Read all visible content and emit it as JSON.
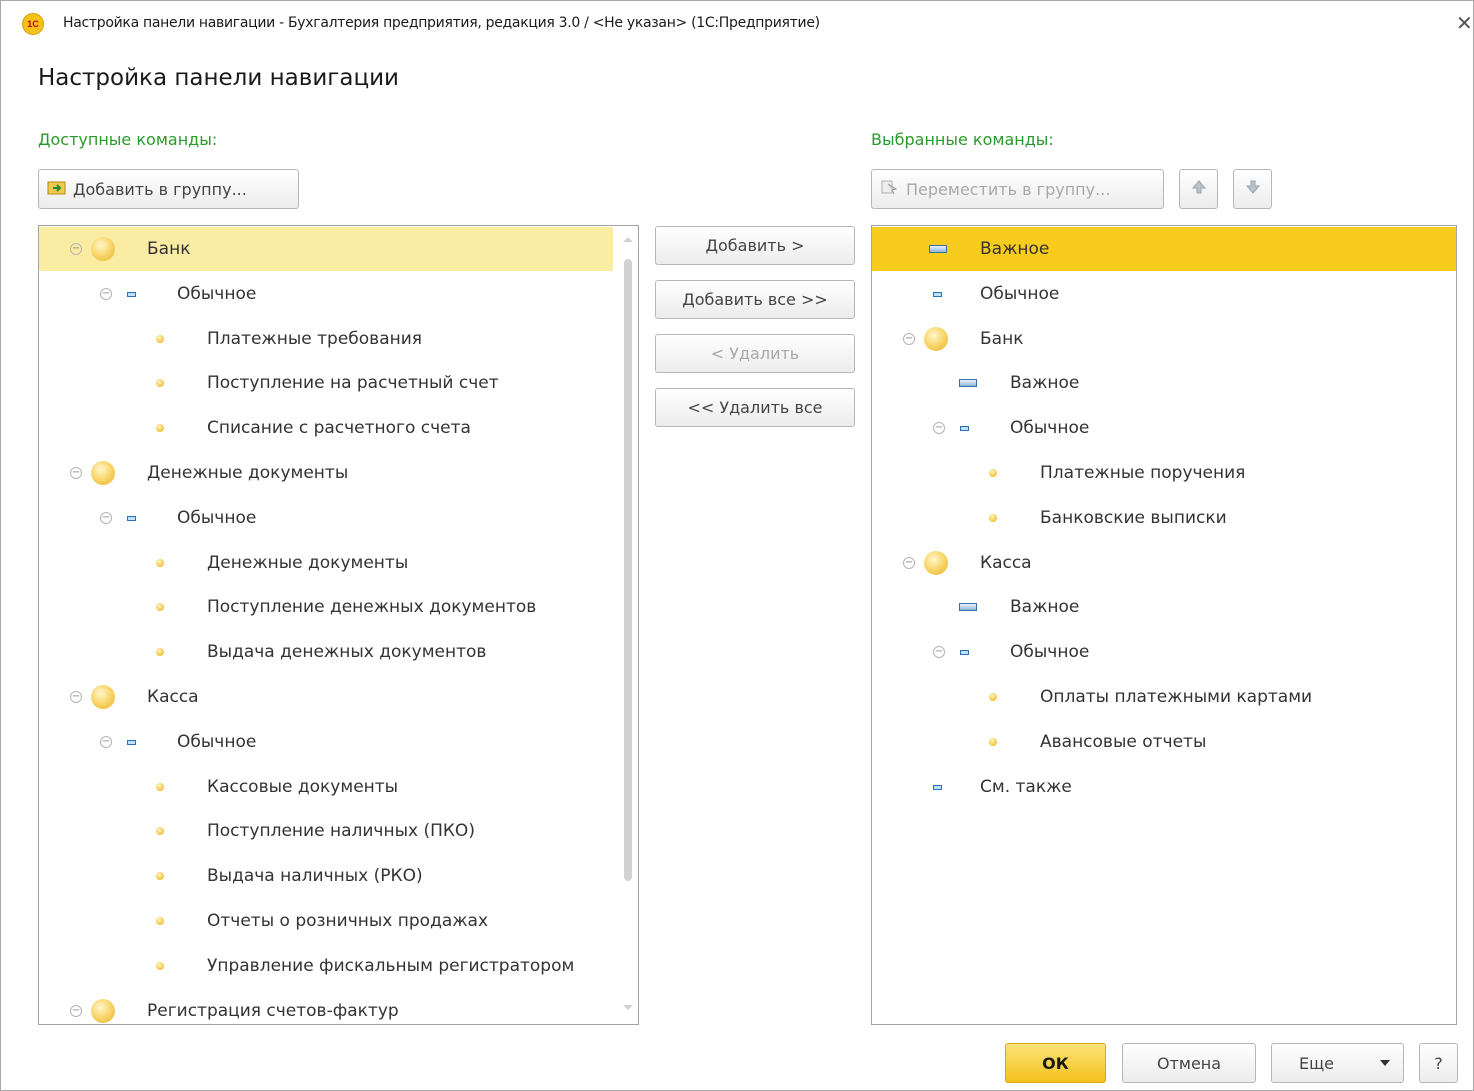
{
  "window": {
    "title": "Настройка панели навигации - Бухгалтерия предприятия, редакция 3.0 / <Не указан>  (1С:Предприятие)",
    "logo_text": "1С"
  },
  "heading": "Настройка панели навигации",
  "available": {
    "label": "Доступные команды:",
    "add_to_group": "Добавить в группу...",
    "items": [
      {
        "text": "Банк",
        "kind": "group",
        "level": 0
      },
      {
        "text": "Обычное",
        "kind": "sub",
        "level": 1
      },
      {
        "text": "Платежные требования",
        "kind": "cmd",
        "level": 2
      },
      {
        "text": "Поступление на расчетный счет",
        "kind": "cmd",
        "level": 2
      },
      {
        "text": "Списание с расчетного счета",
        "kind": "cmd",
        "level": 2
      },
      {
        "text": "Денежные документы",
        "kind": "group",
        "level": 0
      },
      {
        "text": "Обычное",
        "kind": "sub",
        "level": 1
      },
      {
        "text": "Денежные документы",
        "kind": "cmd",
        "level": 2
      },
      {
        "text": "Поступление денежных документов",
        "kind": "cmd",
        "level": 2
      },
      {
        "text": "Выдача денежных документов",
        "kind": "cmd",
        "level": 2
      },
      {
        "text": "Касса",
        "kind": "group",
        "level": 0
      },
      {
        "text": "Обычное",
        "kind": "sub",
        "level": 1
      },
      {
        "text": "Кассовые документы",
        "kind": "cmd",
        "level": 2
      },
      {
        "text": "Поступление наличных (ПКО)",
        "kind": "cmd",
        "level": 2
      },
      {
        "text": "Выдача наличных (РКО)",
        "kind": "cmd",
        "level": 2
      },
      {
        "text": "Отчеты о розничных продажах",
        "kind": "cmd",
        "level": 2
      },
      {
        "text": "Управление фискальным регистратором",
        "kind": "cmd",
        "level": 2
      },
      {
        "text": "Регистрация счетов-фактур",
        "kind": "group",
        "level": 0
      }
    ]
  },
  "middle": {
    "add": "Добавить >",
    "add_all": "Добавить все >>",
    "remove": "< Удалить",
    "remove_all": "<< Удалить все"
  },
  "selected": {
    "label": "Выбранные команды:",
    "move_to_group": "Переместить в группу...",
    "items": [
      {
        "text": "Важное",
        "kind": "important",
        "level": 0
      },
      {
        "text": "Обычное",
        "kind": "plain",
        "level": 0
      },
      {
        "text": "Банк",
        "kind": "group",
        "level": 0
      },
      {
        "text": "Важное",
        "kind": "important",
        "level": 1
      },
      {
        "text": "Обычное",
        "kind": "sub",
        "level": 1
      },
      {
        "text": "Платежные поручения",
        "kind": "cmd",
        "level": 2
      },
      {
        "text": "Банковские выписки",
        "kind": "cmd",
        "level": 2
      },
      {
        "text": "Касса",
        "kind": "group",
        "level": 0
      },
      {
        "text": "Важное",
        "kind": "important",
        "level": 1
      },
      {
        "text": "Обычное",
        "kind": "sub",
        "level": 1
      },
      {
        "text": "Оплаты платежными картами",
        "kind": "cmd",
        "level": 2
      },
      {
        "text": "Авансовые отчеты",
        "kind": "cmd",
        "level": 2
      },
      {
        "text": "См. также",
        "kind": "plain",
        "level": 0
      }
    ]
  },
  "footer": {
    "ok": "ОК",
    "cancel": "Отмена",
    "more": "Еще",
    "help": "?"
  }
}
